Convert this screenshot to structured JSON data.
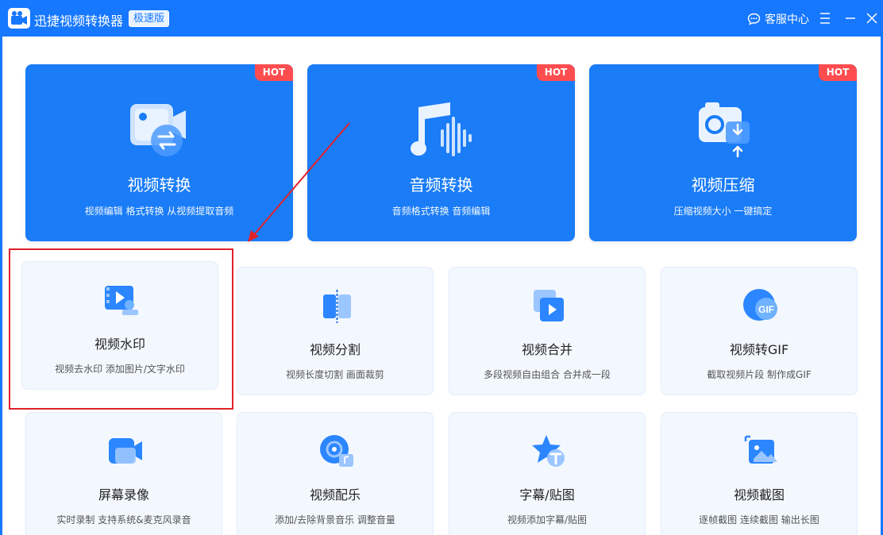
{
  "titlebar": {
    "app_title": "迅捷视频转换器",
    "edition": "极速版",
    "support_label": "客服中心",
    "icons": [
      "app-logo-icon",
      "chat-icon",
      "menu-icon",
      "minimize-icon",
      "close-icon"
    ]
  },
  "colors": {
    "brand": "#1677ff",
    "card_blue": "#1a7cf7",
    "hot": "#ff4d4f",
    "annotation_red": "#e0222b"
  },
  "big_cards": [
    {
      "title": "视频转换",
      "subtitle": "视频编辑 格式转换 从视频提取音频",
      "badge": "HOT",
      "icon": "video-convert-icon"
    },
    {
      "title": "音频转换",
      "subtitle": "音频格式转换 音频编辑",
      "badge": "HOT",
      "icon": "audio-convert-icon"
    },
    {
      "title": "视频压缩",
      "subtitle": "压缩视频大小 一键搞定",
      "badge": "HOT",
      "icon": "video-compress-icon"
    }
  ],
  "small_cards": [
    {
      "title": "视频水印",
      "subtitle": "视频去水印 添加图片/文字水印",
      "icon": "video-watermark-icon"
    },
    {
      "title": "视频分割",
      "subtitle": "视频长度切割 画面裁剪",
      "icon": "video-split-icon"
    },
    {
      "title": "视频合并",
      "subtitle": "多段视频自由组合 合并成一段",
      "icon": "video-merge-icon"
    },
    {
      "title": "视频转GIF",
      "subtitle": "截取视频片段 制作成GIF",
      "icon": "video-gif-icon"
    },
    {
      "title": "屏幕录像",
      "subtitle": "实时录制 支持系统&麦克风录音",
      "icon": "screen-record-icon"
    },
    {
      "title": "视频配乐",
      "subtitle": "添加/去除背景音乐 调整音量",
      "icon": "video-music-icon"
    },
    {
      "title": "字幕/贴图",
      "subtitle": "视频添加字幕/贴图",
      "icon": "subtitle-sticker-icon"
    },
    {
      "title": "视频截图",
      "subtitle": "逐帧截图 连续截图 输出长图",
      "icon": "video-screenshot-icon"
    }
  ],
  "gif_icon_text": "GIF"
}
